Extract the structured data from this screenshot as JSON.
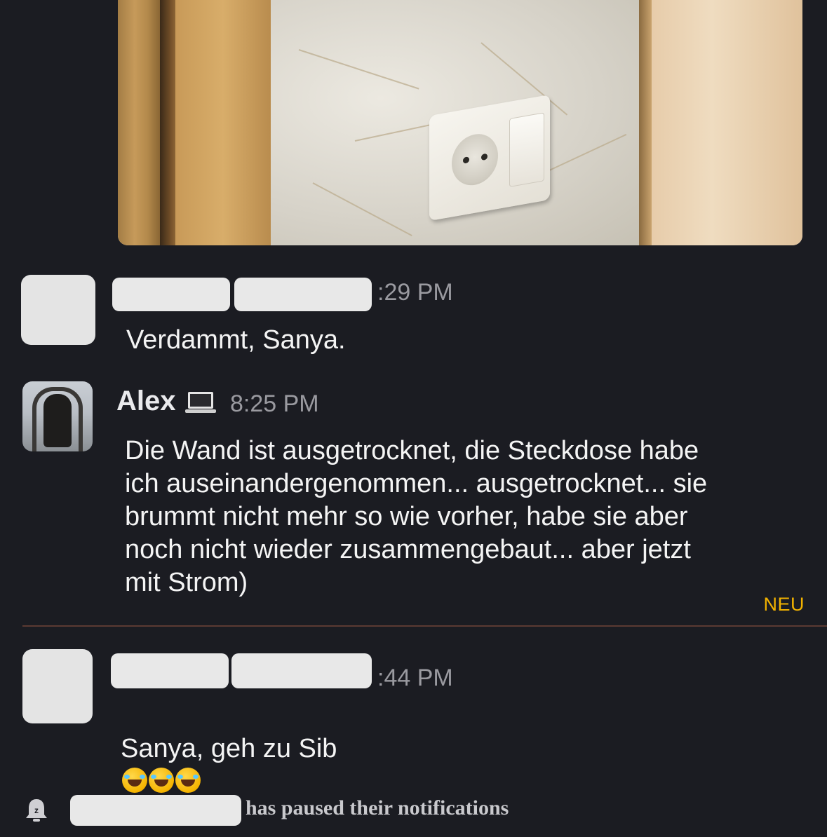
{
  "messages": [
    {
      "time": ":29 PM",
      "text": "Verdammt, Sanya."
    },
    {
      "sender": "Alex",
      "time": "8:25 PM",
      "text": "Die Wand ist ausgetrocknet, die Steckdose habe\nich auseinandergenommen... ausgetrocknet... sie\nbrummt nicht mehr so wie vorher, habe sie aber\nnoch nicht wieder zusammengebaut... aber jetzt\nmit Strom)"
    },
    {
      "time": ":44 PM",
      "text": "Sanya, geh zu Sib",
      "emoji_count": 3,
      "emoji_icon": "rolling-on-floor-laughing-emoji"
    }
  ],
  "divider": {
    "label": "NEU",
    "color": "#f2b200"
  },
  "system_event": {
    "text": "has paused their notifications",
    "icon": "bell-snooze-icon"
  },
  "colors": {
    "background": "#1b1c22",
    "message_text": "#f4f4f4",
    "timestamp": "#9a9aa0",
    "divider_line": "#5b3a32"
  }
}
